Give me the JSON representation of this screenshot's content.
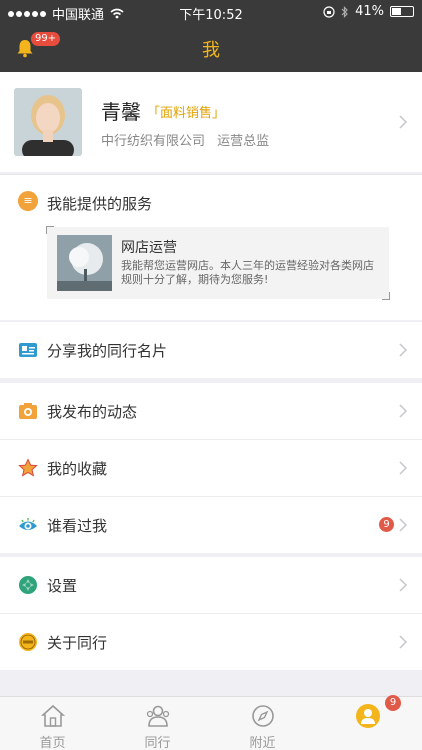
{
  "status_bar": {
    "carrier": "中国联通",
    "time": "下午10:52",
    "battery": "41%"
  },
  "header": {
    "title": "我",
    "notification_count": "99+"
  },
  "profile": {
    "name": "青馨",
    "role": "「面料销售」",
    "company": "中行纺织有限公司",
    "position": "运营总监"
  },
  "services": {
    "section_title": "我能提供的服务",
    "item_title": "网店运营",
    "item_desc": "我能帮您运营网店。本人三年的运营经验对各类网店规则十分了解，期待为您服务!"
  },
  "menu": {
    "share_card": "分享我的同行名片",
    "my_posts": "我发布的动态",
    "favorites": "我的收藏",
    "who_viewed": "谁看过我",
    "who_viewed_count": "9",
    "settings": "设置",
    "about": "关于同行"
  },
  "tabbar": {
    "tabs": [
      {
        "label": "首页"
      },
      {
        "label": "同行"
      },
      {
        "label": "附近"
      }
    ],
    "me_badge": "9"
  },
  "colors": {
    "accent": "#f3b51b",
    "header_bg": "#3a3a3a",
    "badge": "#e05a4a"
  }
}
